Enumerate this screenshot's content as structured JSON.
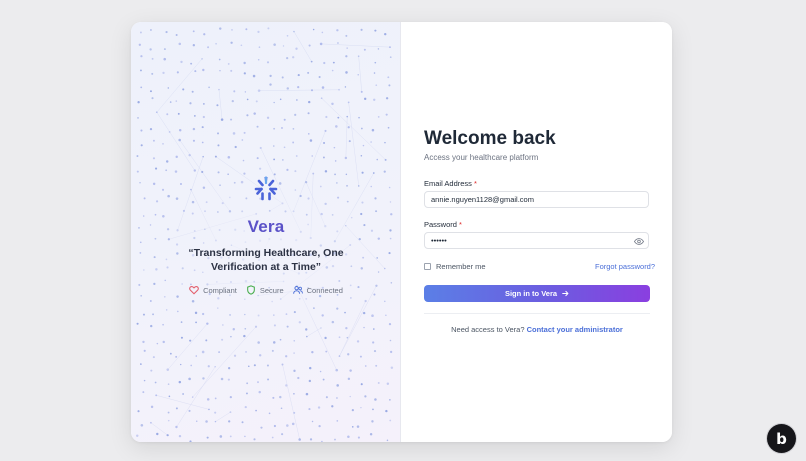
{
  "brand": {
    "name": "Vera",
    "tagline": "“Transforming Healthcare, One Verification at a Time”",
    "badges": [
      {
        "label": "Compliant",
        "icon": "heart-icon",
        "color": "#e35d6a"
      },
      {
        "label": "Secure",
        "icon": "shield-icon",
        "color": "#4caf50"
      },
      {
        "label": "Connected",
        "icon": "users-icon",
        "color": "#4b6fd8"
      }
    ],
    "accent": "#5b52c8"
  },
  "login": {
    "title": "Welcome back",
    "subtitle": "Access your healthcare platform",
    "email": {
      "label": "Email Address",
      "required_mark": "*",
      "value": "annie.nguyen1128@gmail.com"
    },
    "password": {
      "label": "Password",
      "required_mark": "*",
      "value": "••••••"
    },
    "remember_label": "Remember me",
    "forgot_label": "Forgot password?",
    "signin_label": "Sign in to Vera",
    "access_prompt": "Need access to Vera?",
    "access_link": "Contact your administrator",
    "link_color": "#4b6fd8"
  },
  "corner_badge": {
    "letter": "b"
  }
}
